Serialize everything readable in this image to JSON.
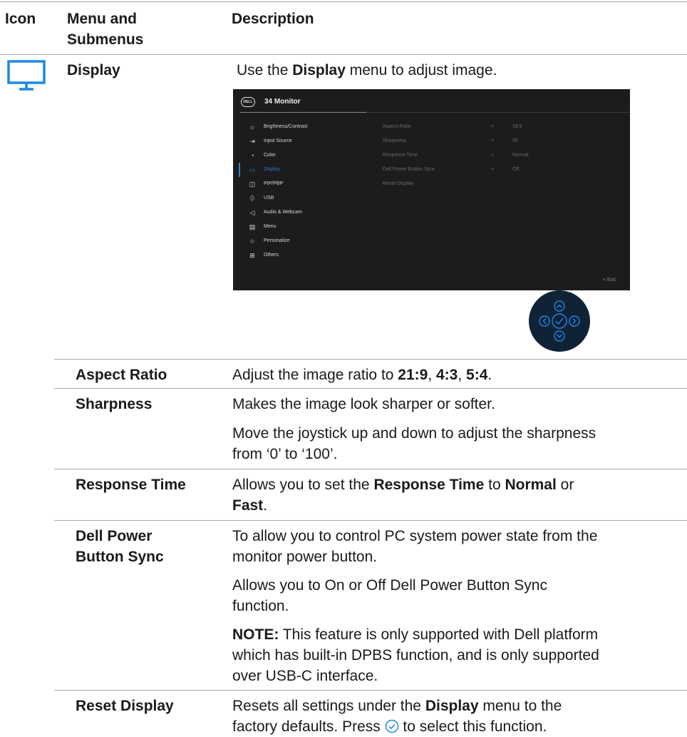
{
  "header": {
    "icon": "Icon",
    "menu_line1": "Menu and",
    "menu_line2": "Submenus",
    "description": "Description"
  },
  "display_row": {
    "icon_name": "monitor-icon",
    "menu": "Display",
    "desc_pre": "Use the ",
    "desc_bold": "Display",
    "desc_post": " menu to adjust image."
  },
  "osd": {
    "title": "34 Monitor",
    "logo": "DELL",
    "menu_items": [
      {
        "icon": "brightness-icon",
        "glyph": "☼",
        "label": "Brightness/Contrast"
      },
      {
        "icon": "input-source-icon",
        "glyph": "⇥",
        "label": "Input Source"
      },
      {
        "icon": "color-icon",
        "glyph": "◔",
        "label": "Color"
      },
      {
        "icon": "display-icon",
        "glyph": "▭",
        "label": "Display"
      },
      {
        "icon": "pip-pbp-icon",
        "glyph": "◫",
        "label": "PIP/PBP"
      },
      {
        "icon": "usb-icon",
        "glyph": "⏀",
        "label": "USB"
      },
      {
        "icon": "audio-webcam-icon",
        "glyph": "◁",
        "label": "Audio & Webcam"
      },
      {
        "icon": "menu-icon",
        "glyph": "▤",
        "label": "Menu"
      },
      {
        "icon": "personalize-icon",
        "glyph": "☆",
        "label": "Personalize"
      },
      {
        "icon": "others-icon",
        "glyph": "⊞",
        "label": "Others"
      }
    ],
    "active_index": 3,
    "submenu": [
      {
        "name": "Aspect Ratio",
        "arrow": ">",
        "value": "16:9"
      },
      {
        "name": "Sharpness",
        "arrow": ">",
        "value": "50"
      },
      {
        "name": "Response Time",
        "arrow": ">",
        "value": "Normal"
      },
      {
        "name": "Dell Power Button Sync",
        "arrow": ">",
        "value": "Off"
      },
      {
        "name": "Reset Display",
        "arrow": "",
        "value": ""
      }
    ],
    "exit": "<  Exit"
  },
  "rows": {
    "aspect": {
      "term": "Aspect Ratio",
      "d1": "Adjust the image ratio to ",
      "b1": "21:9",
      "s1": ", ",
      "b2": "4:3",
      "s2": ", ",
      "b3": "5:4",
      "s3": "."
    },
    "sharpness": {
      "term": "Sharpness",
      "p1": "Makes the image look sharper or softer.",
      "p2_l1": "Move the joystick up and down to adjust the sharpness",
      "p2_l2": "from ‘0’ to ‘100’."
    },
    "response": {
      "term": "Response Time",
      "l1_a": "Allows you to set the ",
      "l1_b": "Response Time",
      "l1_c": " to ",
      "l1_d": "Normal",
      "l1_e": " or",
      "l2_b": "Fast",
      "l2_c": "."
    },
    "dpbs": {
      "term_l1": "Dell Power",
      "term_l2": "Button Sync",
      "p1_l1": "To allow you to control PC system power state from the",
      "p1_l2": "monitor power button.",
      "p2_l1": "Allows you to On or Off Dell Power Button Sync",
      "p2_l2": "function.",
      "note_label": "NOTE:",
      "note_l1": " This feature is only supported with Dell platform",
      "note_l2": "which has built-in DPBS function, and is only supported",
      "note_l3": "over USB-C interface."
    },
    "reset": {
      "term": "Reset Display",
      "l1_a": "Resets all settings under the ",
      "l1_b": "Display",
      "l1_c": " menu to the",
      "l2_a": "factory defaults. Press ",
      "l2_icon": "check-circle-icon",
      "l2_b": " to select this function."
    }
  },
  "colors": {
    "accent_blue": "#1e88e5",
    "osd_bg": "#1c1c1c",
    "joystick_bg": "#0f2236"
  }
}
